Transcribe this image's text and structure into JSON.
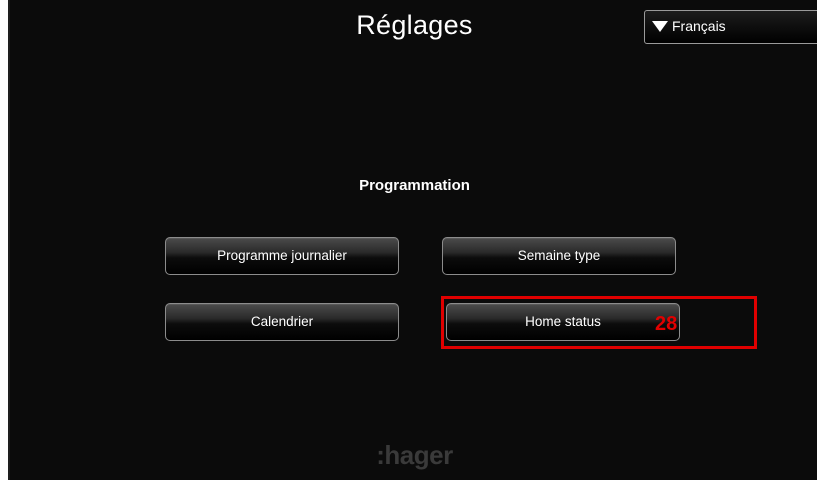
{
  "header": {
    "title": "Réglages",
    "language_selector": {
      "selected": "Français",
      "icon": "triangle-down-icon"
    }
  },
  "main": {
    "section_title": "Programmation",
    "buttons": {
      "daily_program": "Programme journalier",
      "typical_week": "Semaine type",
      "calendar": "Calendrier",
      "home_status": "Home status"
    }
  },
  "annotation": {
    "label": "28",
    "color": "#e00000"
  },
  "footer": {
    "logo_text": ":hager"
  },
  "colors": {
    "background": "#0b0b0b",
    "text": "#ffffff",
    "logo": "#3a3a3a"
  }
}
